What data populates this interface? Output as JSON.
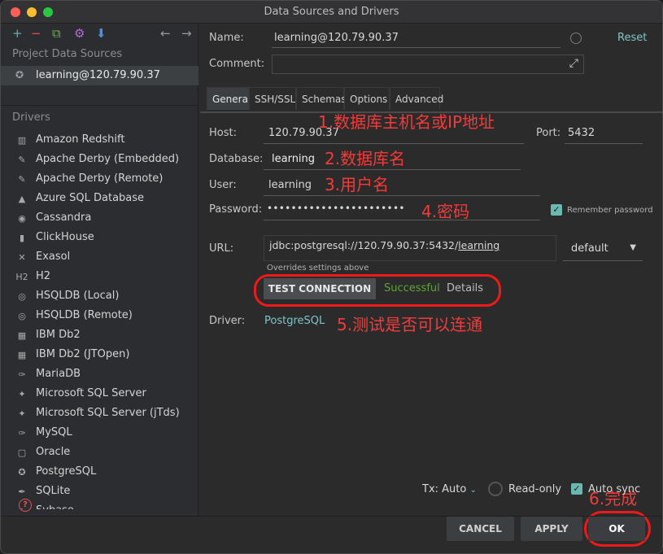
{
  "window": {
    "title": "Data Sources and Drivers"
  },
  "sidebar": {
    "toolbar": [
      {
        "name": "add-icon",
        "glyph": "+",
        "color": "#5fb0b7"
      },
      {
        "name": "remove-icon",
        "glyph": "−",
        "color": "#e05252"
      },
      {
        "name": "copy-icon",
        "glyph": "⧉",
        "color": "#6ab04c"
      },
      {
        "name": "gear-icon",
        "glyph": "⚙",
        "color": "#b46bd6"
      },
      {
        "name": "import-icon",
        "glyph": "⬇",
        "color": "#4a90e2"
      },
      {
        "name": "back-arrow-icon",
        "glyph": "←",
        "color": "#9a9a9a"
      },
      {
        "name": "forward-arrow-icon",
        "glyph": "→",
        "color": "#9a9a9a"
      }
    ],
    "project_title": "Project Data Sources",
    "project_item": "learning@120.79.90.37",
    "drivers_title": "Drivers",
    "drivers": [
      {
        "label": "Amazon Redshift",
        "icon": "▥"
      },
      {
        "label": "Apache Derby (Embedded)",
        "icon": "✎"
      },
      {
        "label": "Apache Derby (Remote)",
        "icon": "✎"
      },
      {
        "label": "Azure SQL Database",
        "icon": "▲"
      },
      {
        "label": "Cassandra",
        "icon": "◉"
      },
      {
        "label": "ClickHouse",
        "icon": "▮"
      },
      {
        "label": "Exasol",
        "icon": "✕"
      },
      {
        "label": "H2",
        "icon": "H2"
      },
      {
        "label": "HSQLDB (Local)",
        "icon": "◎"
      },
      {
        "label": "HSQLDB (Remote)",
        "icon": "◎"
      },
      {
        "label": "IBM Db2",
        "icon": "▦"
      },
      {
        "label": "IBM Db2 (JTOpen)",
        "icon": "▦"
      },
      {
        "label": "MariaDB",
        "icon": "✑"
      },
      {
        "label": "Microsoft SQL Server",
        "icon": "✦"
      },
      {
        "label": "Microsoft SQL Server (jTds)",
        "icon": "✦"
      },
      {
        "label": "MySQL",
        "icon": "✑"
      },
      {
        "label": "Oracle",
        "icon": "▢"
      },
      {
        "label": "PostgreSQL",
        "icon": "✪"
      },
      {
        "label": "SQLite",
        "icon": "✒"
      },
      {
        "label": "Sybase",
        "icon": "◆"
      }
    ]
  },
  "header": {
    "name_label": "Name:",
    "name_value": "learning@120.79.90.37",
    "reset": "Reset",
    "comment_label": "Comment:",
    "expand_glyph": "⤢"
  },
  "tabs": [
    {
      "label": "General",
      "active": true
    },
    {
      "label": "SSH/SSL",
      "active": false
    },
    {
      "label": "Schemas",
      "active": false
    },
    {
      "label": "Options",
      "active": false
    },
    {
      "label": "Advanced",
      "active": false
    }
  ],
  "general": {
    "host_label": "Host:",
    "host_value": "120.79.90.37",
    "port_label": "Port:",
    "port_value": "5432",
    "database_label": "Database:",
    "database_value": "learning",
    "user_label": "User:",
    "user_value": "learning",
    "password_label": "Password:",
    "password_value": "•••••••••••••••••••••••",
    "remember_label": "Remember password",
    "url_label": "URL:",
    "url_prefix": "jdbc:postgresql://120.79.90.37:5432/",
    "url_db": "learning",
    "url_mode": "default",
    "overrides_note": "Overrides settings above",
    "test_button": "TEST CONNECTION",
    "test_status": "Successful",
    "details": "Details",
    "driver_label": "Driver:",
    "driver_value": "PostgreSQL"
  },
  "annotations": {
    "a1": "1.数据库主机名或IP地址",
    "a2": "2.数据库名",
    "a3": "3.用户名",
    "a4": "4.密码",
    "a5": "5.测试是否可以连通",
    "a6": "6.完成"
  },
  "footer": {
    "tx_label": "Tx: Auto",
    "readonly_label": "Read-only",
    "autosync_label": "Auto sync",
    "cancel": "CANCEL",
    "apply": "APPLY",
    "ok": "OK"
  }
}
